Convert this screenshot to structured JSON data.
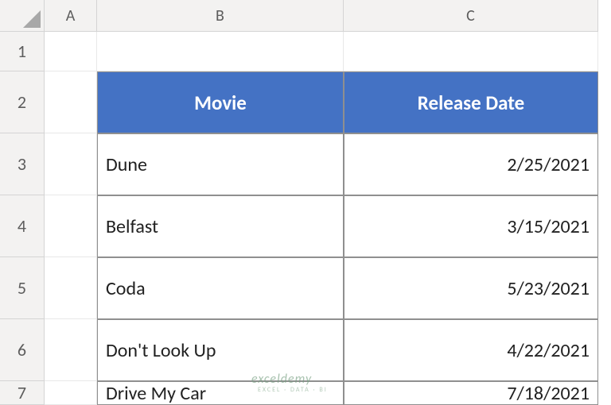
{
  "columns": [
    "A",
    "B",
    "C"
  ],
  "rows": [
    "1",
    "2",
    "3",
    "4",
    "5",
    "6",
    "7"
  ],
  "table": {
    "headers": {
      "movie": "Movie",
      "release": "Release Date"
    },
    "data": [
      {
        "movie": "Dune",
        "release": "2/25/2021"
      },
      {
        "movie": "Belfast",
        "release": "3/15/2021"
      },
      {
        "movie": "Coda",
        "release": "5/23/2021"
      },
      {
        "movie": "Don't Look Up",
        "release": "4/22/2021"
      },
      {
        "movie": "Drive My Car",
        "release": "7/18/2021"
      }
    ]
  },
  "watermark": {
    "main": "exceldemy",
    "sub": "EXCEL · DATA · BI"
  }
}
